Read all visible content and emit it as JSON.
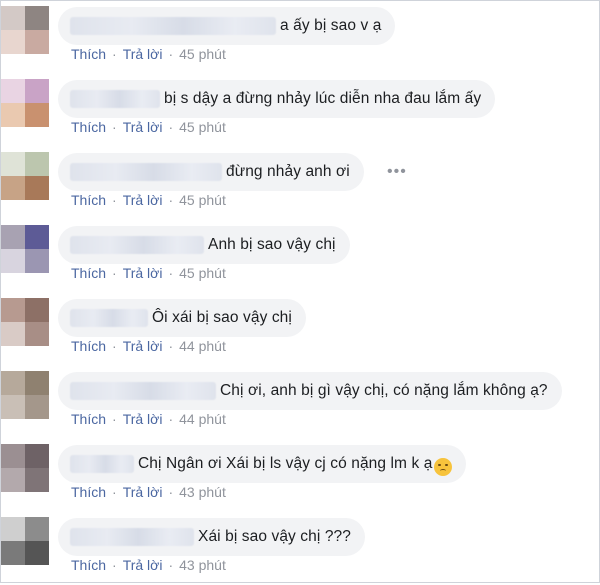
{
  "comments": [
    {
      "text": "a ấy bị sao v ạ",
      "like": "Thích",
      "reply": "Trả lời",
      "time": "45 phút",
      "avatar_colors": [
        "#d3c9c6",
        "#8e8582",
        "#e8d6cf",
        "#c9aaa1"
      ]
    },
    {
      "text": "bị s dậy a đừng nhảy lúc diễn nha đau lắm ấy",
      "like": "Thích",
      "reply": "Trả lời",
      "time": "45 phút",
      "avatar_colors": [
        "#e9d4e3",
        "#c9a3c6",
        "#eac9b0",
        "#c9916f"
      ]
    },
    {
      "text": "đừng nhảy anh ơi",
      "like": "Thích",
      "reply": "Trả lời",
      "time": "45 phút",
      "avatar_colors": [
        "#dfe3d7",
        "#bcc6ae",
        "#c7a386",
        "#a87959"
      ]
    },
    {
      "text": "Anh bị sao vậy chị",
      "like": "Thích",
      "reply": "Trả lời",
      "time": "45 phút",
      "avatar_colors": [
        "#a8a2b2",
        "#5d5b96",
        "#d8d4df",
        "#9b96b2"
      ]
    },
    {
      "text": "Ôi xái bị sao vậy chị",
      "like": "Thích",
      "reply": "Trả lời",
      "time": "44 phút",
      "avatar_colors": [
        "#b79a90",
        "#8d7066",
        "#d9cbc6",
        "#a88e86"
      ]
    },
    {
      "text": "Chị ơi, anh bị gì vậy chị, có nặng lắm không ạ?",
      "like": "Thích",
      "reply": "Trả lời",
      "time": "44 phút",
      "avatar_colors": [
        "#b6a99b",
        "#8f8170",
        "#c9bfb6",
        "#a4978b"
      ]
    },
    {
      "text": "Chị Ngân ơi Xái bị ls vậy cj có nặng lm k ạ",
      "like": "Thích",
      "reply": "Trả lời",
      "time": "43 phút",
      "avatar_colors": [
        "#9b8f92",
        "#6e6266",
        "#b3a9ac",
        "#7f7477"
      ]
    },
    {
      "text": "Xái bị sao vậy chị ???",
      "like": "Thích",
      "reply": "Trả lời",
      "time": "43 phút",
      "avatar_colors": [
        "#cfcfcf",
        "#8c8c8c",
        "#7a7a7a",
        "#555555"
      ]
    }
  ],
  "more_icon": "ellipsis-horizontal-icon",
  "emoji_icon": "disappointed-face-emoji"
}
